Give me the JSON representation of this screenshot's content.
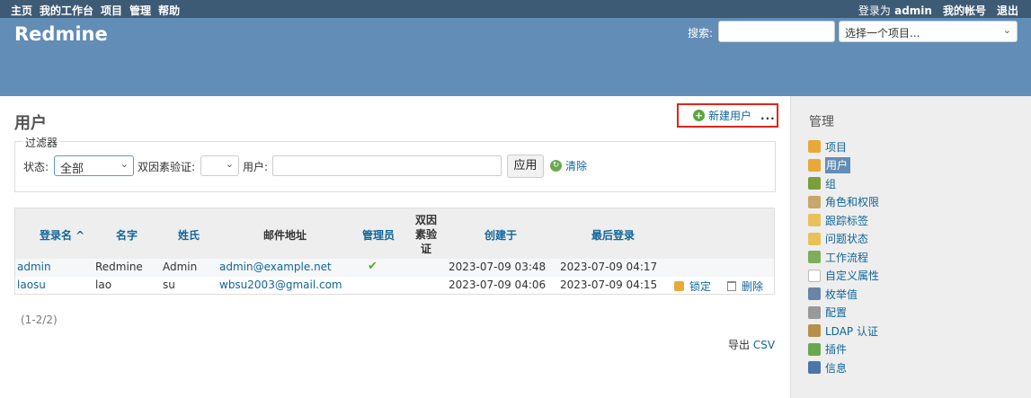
{
  "top_menu": {
    "left": [
      "主页",
      "我的工作台",
      "项目",
      "管理",
      "帮助"
    ],
    "logged_in_as": "登录为",
    "user": "admin",
    "my_account": "我的帐号",
    "logout": "退出"
  },
  "header": {
    "app_title": "Redmine",
    "search_label": "搜索:",
    "search_value": "",
    "project_select": "选择一个项目..."
  },
  "content": {
    "page_title": "用户",
    "new_user": "新建用户",
    "more": "...",
    "filters": {
      "legend": "过滤器",
      "status_label": "状态:",
      "status_value": "全部",
      "twofa_label": "双因素验证:",
      "twofa_value": "",
      "user_label": "用户:",
      "user_value": "",
      "apply": "应用",
      "clear": "清除"
    },
    "table": {
      "headers": {
        "login": "登录名 ^",
        "firstname": "名字",
        "lastname": "姓氏",
        "mail": "邮件地址",
        "admin": "管理员",
        "twofa": "双因素验证",
        "created": "创建于",
        "last_login": "最后登录"
      },
      "rows": [
        {
          "login": "admin",
          "firstname": "Redmine",
          "lastname": "Admin",
          "mail": "admin@example.net",
          "admin": true,
          "created": "2023-07-09 03:48",
          "last_login": "2023-07-09 04:17"
        },
        {
          "login": "laosu",
          "firstname": "lao",
          "lastname": "su",
          "mail": "wbsu2003@gmail.com",
          "admin": false,
          "created": "2023-07-09 04:06",
          "last_login": "2023-07-09 04:15",
          "lock": "锁定",
          "delete": "删除"
        }
      ]
    },
    "pagination": "(1-2/2)",
    "export_label": "导出",
    "export_csv": "CSV"
  },
  "sidebar": {
    "title": "管理",
    "items": [
      {
        "label": "项目",
        "icon": "projects-icon",
        "color": "#e8a93a"
      },
      {
        "label": "用户",
        "icon": "user-icon",
        "color": "#e8a93a",
        "selected": true
      },
      {
        "label": "组",
        "icon": "group-icon",
        "color": "#7a9e3b"
      },
      {
        "label": "角色和权限",
        "icon": "roles-icon",
        "color": "#c9a66b"
      },
      {
        "label": "跟踪标签",
        "icon": "tracker-icon",
        "color": "#e8c15a"
      },
      {
        "label": "问题状态",
        "icon": "issue-status-icon",
        "color": "#e8c15a"
      },
      {
        "label": "工作流程",
        "icon": "workflow-icon",
        "color": "#7fae5a"
      },
      {
        "label": "自定义属性",
        "icon": "custom-fields-icon",
        "color": "#ffffff"
      },
      {
        "label": "枚举值",
        "icon": "enumerations-icon",
        "color": "#6a84a6"
      },
      {
        "label": "配置",
        "icon": "settings-icon",
        "color": "#999999"
      },
      {
        "label": "LDAP 认证",
        "icon": "ldap-icon",
        "color": "#b88f4a"
      },
      {
        "label": "插件",
        "icon": "plugins-icon",
        "color": "#6aa84f"
      },
      {
        "label": "信息",
        "icon": "info-icon",
        "color": "#4a76a8"
      }
    ]
  }
}
